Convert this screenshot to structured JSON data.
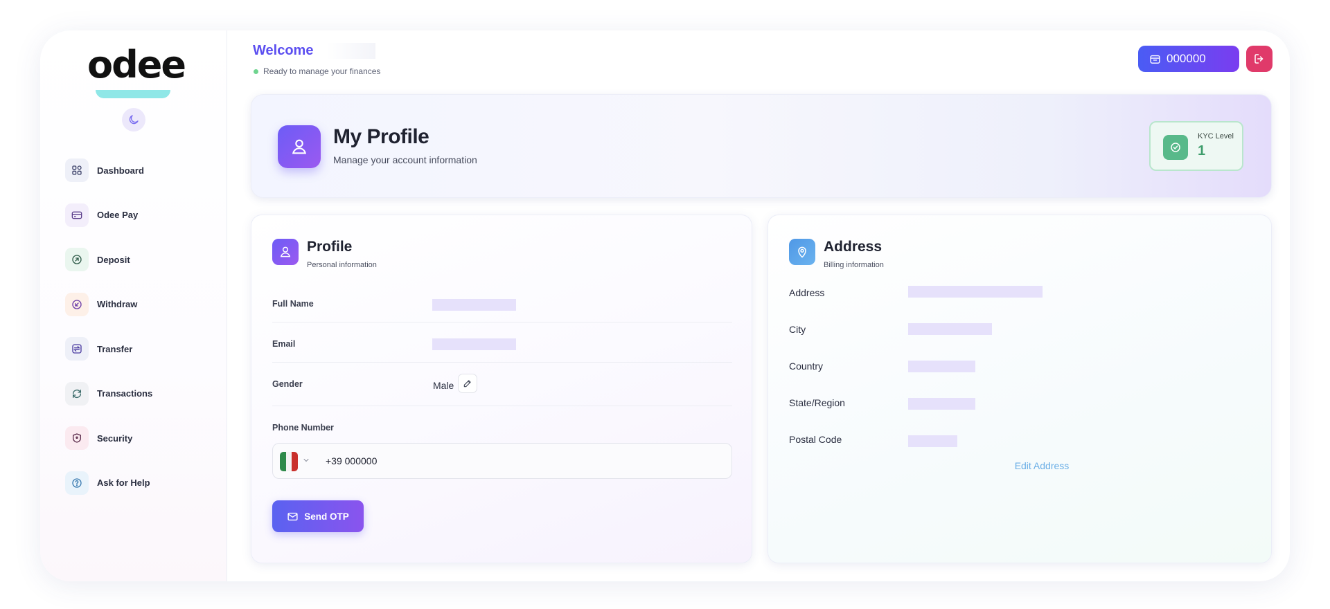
{
  "brand": {
    "logo_text": "odee"
  },
  "sidebar": {
    "items": [
      {
        "label": "Dashboard",
        "icon": "grid-icon"
      },
      {
        "label": "Odee Pay",
        "icon": "card-icon"
      },
      {
        "label": "Deposit",
        "icon": "arrow-up-circle-icon"
      },
      {
        "label": "Withdraw",
        "icon": "arrow-down-circle-icon"
      },
      {
        "label": "Transfer",
        "icon": "transfer-icon"
      },
      {
        "label": "Transactions",
        "icon": "refresh-icon"
      },
      {
        "label": "Security",
        "icon": "shield-icon"
      },
      {
        "label": "Ask for Help",
        "icon": "help-icon"
      }
    ]
  },
  "header": {
    "welcome": "Welcome",
    "status": "Ready to manage your finances",
    "wallet_value": "000000"
  },
  "hero": {
    "title": "My Profile",
    "subtitle": "Manage your account information",
    "kyc_label": "KYC Level",
    "kyc_value": "1"
  },
  "profile": {
    "title": "Profile",
    "subtitle": "Personal information",
    "full_name_label": "Full Name",
    "email_label": "Email",
    "gender_label": "Gender",
    "gender_value": "Male",
    "phone_label": "Phone Number",
    "phone_value": "+39 000000",
    "send_otp": "Send OTP"
  },
  "address": {
    "title": "Address",
    "subtitle": "Billing information",
    "fields": [
      "Address",
      "City",
      "Country",
      "State/Region",
      "Postal Code"
    ],
    "edit_link": "Edit Address"
  },
  "colors": {
    "accent": "#5b4ef0",
    "logout": "#e03a6a",
    "kyc_green": "#58b98a",
    "placeholder": "#e6e1fb",
    "address_blue": "#5da6e8"
  }
}
